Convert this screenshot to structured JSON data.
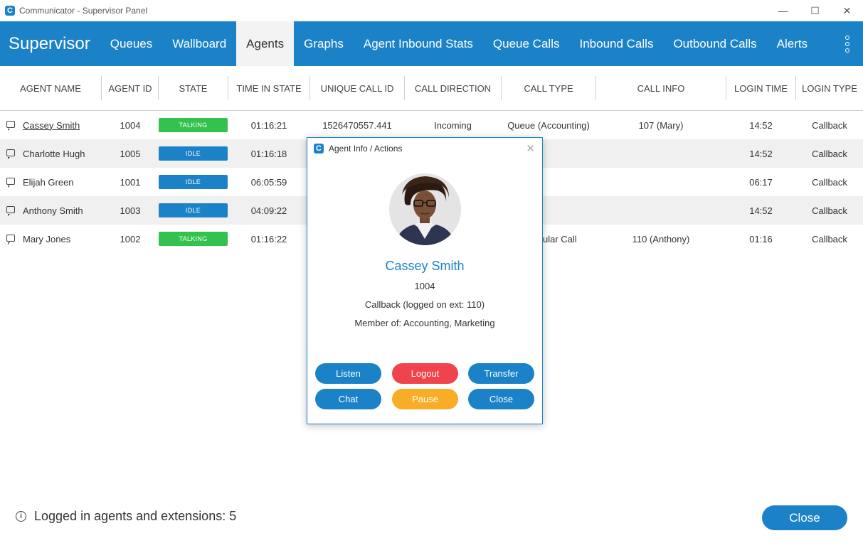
{
  "window": {
    "title": "Communicator - Supervisor Panel",
    "logo_letter": "C"
  },
  "nav": {
    "brand": "Supervisor",
    "tabs": [
      "Queues",
      "Wallboard",
      "Agents",
      "Graphs",
      "Agent Inbound Stats",
      "Queue Calls",
      "Inbound Calls",
      "Outbound Calls",
      "Alerts"
    ],
    "active_tab": "Agents"
  },
  "table": {
    "headers": [
      "AGENT NAME",
      "AGENT ID",
      "STATE",
      "TIME IN STATE",
      "UNIQUE CALL ID",
      "CALL DIRECTION",
      "CALL TYPE",
      "CALL INFO",
      "LOGIN TIME",
      "LOGIN TYPE"
    ],
    "rows": [
      {
        "name": "Cassey Smith",
        "id": "1004",
        "state": "TALKING",
        "time_in_state": "01:16:21",
        "unique_call_id": "1526470557.441",
        "direction": "Incoming",
        "call_type": "Queue (Accounting)",
        "call_info": "107 (Mary)",
        "login_time": "14:52",
        "login_type": "Callback"
      },
      {
        "name": "Charlotte Hugh",
        "id": "1005",
        "state": "IDLE",
        "time_in_state": "01:16:18",
        "unique_call_id": "",
        "direction": "",
        "call_type": "",
        "call_info": "",
        "login_time": "14:52",
        "login_type": "Callback"
      },
      {
        "name": "Elijah Green",
        "id": "1001",
        "state": "IDLE",
        "time_in_state": "06:05:59",
        "unique_call_id": "",
        "direction": "",
        "call_type": "",
        "call_info": "",
        "login_time": "06:17",
        "login_type": "Callback"
      },
      {
        "name": "Anthony Smith",
        "id": "1003",
        "state": "IDLE",
        "time_in_state": "04:09:22",
        "unique_call_id": "",
        "direction": "",
        "call_type": "",
        "call_info": "",
        "login_time": "14:52",
        "login_type": "Callback"
      },
      {
        "name": "Mary Jones",
        "id": "1002",
        "state": "TALKING",
        "time_in_state": "01:16:22",
        "unique_call_id": "",
        "direction": "",
        "call_type": "ular Call",
        "call_info": "110 (Anthony)",
        "login_time": "01:16",
        "login_type": "Callback"
      }
    ]
  },
  "colors": {
    "accent": "#1b82c8",
    "talking": "#33c24d",
    "idle": "#1b82c8",
    "logout": "#f0434b",
    "pause": "#f9ad26"
  },
  "footer": {
    "info_text": "Logged in agents and extensions: 5",
    "close_label": "Close"
  },
  "dialog": {
    "title": "Agent Info / Actions",
    "agent_name": "Cassey Smith",
    "agent_id": "1004",
    "login_info": "Callback (logged on ext: 110)",
    "membership": "Member of: Accounting, Marketing",
    "buttons": {
      "listen": "Listen",
      "logout": "Logout",
      "transfer": "Transfer",
      "chat": "Chat",
      "pause": "Pause",
      "close": "Close"
    }
  }
}
